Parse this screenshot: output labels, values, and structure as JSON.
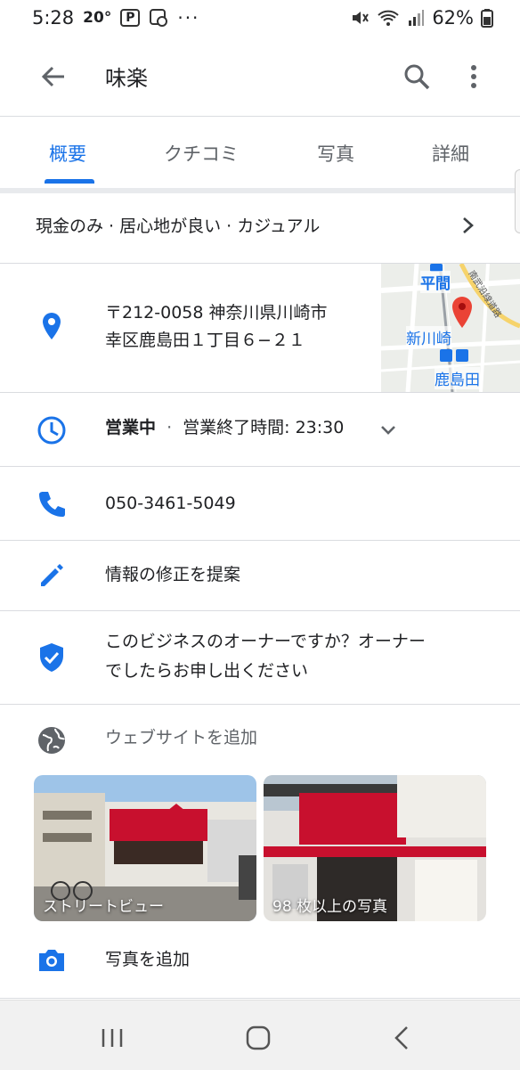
{
  "status_bar": {
    "time": "5:28",
    "temperature": "20°",
    "p_badge": "P",
    "dots": "···",
    "battery": "62%"
  },
  "app_bar": {
    "title": "味楽",
    "icons": [
      "arrow-back-icon",
      "search-icon",
      "more-vert-icon"
    ]
  },
  "tabs": [
    {
      "label": "概要",
      "active": true
    },
    {
      "label": "クチコミ",
      "active": false
    },
    {
      "label": "写真",
      "active": false
    },
    {
      "label": "詳細",
      "active": false
    }
  ],
  "attributes": {
    "text": "現金のみ · 居心地が良い · カジュアル"
  },
  "address": {
    "line1": "〒212-0058 神奈川県川崎市",
    "line2": "幸区鹿島田１丁目６−２１"
  },
  "map": {
    "labels": {
      "station1": "平間",
      "station2": "新川崎",
      "station3": "鹿島田",
      "road": "南武沿線道路"
    }
  },
  "hours": {
    "status": "営業中",
    "separator": "·",
    "closing": "営業終了時間: 23:30"
  },
  "phone": {
    "number": "050-3461-5049"
  },
  "suggest_edit": {
    "label": "情報の修正を提案"
  },
  "owner_claim": {
    "line1": "このビジネスのオーナーですか？オーナー",
    "line2": "でしたらお申し出ください"
  },
  "website": {
    "label": "ウェブサイトを追加"
  },
  "photos": [
    {
      "caption": "ストリートビュー"
    },
    {
      "caption": "98 枚以上の写真"
    }
  ],
  "add_photo": {
    "label": "写真を追加"
  },
  "colors": {
    "accent": "#1a73e8",
    "pin_red": "#ea4335",
    "divider": "#dadce0",
    "secondary_text": "#5f6368"
  }
}
